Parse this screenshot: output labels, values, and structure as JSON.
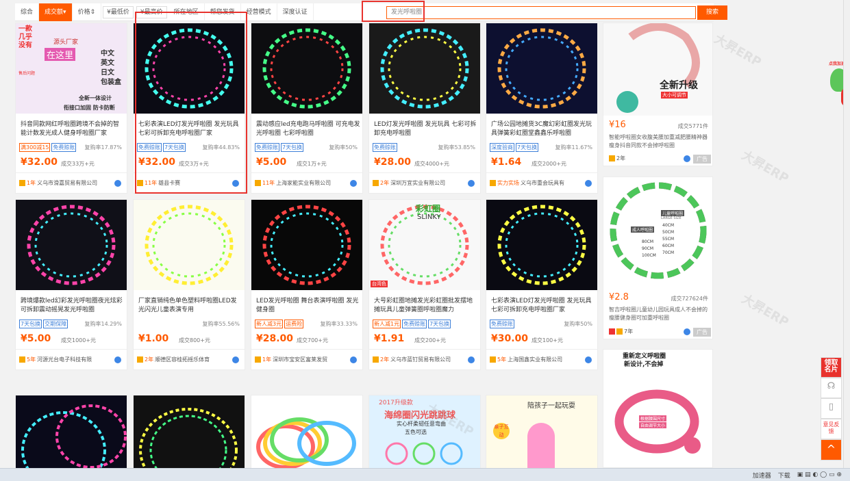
{
  "filter_bar": {
    "tabs": [
      "综合",
      "成交额",
      "价格"
    ],
    "price_min": "¥最低价",
    "price_max": "¥最高价",
    "filters": [
      "所在地区",
      "帮您发货",
      "经营模式",
      "深度认证"
    ],
    "search_placeholder": "发光呼啦圈",
    "search_button": "搜索"
  },
  "products": [
    {
      "title": "抖音同款网红呼啦圈跨境不会掉的智能计数发光成人健身呼啦圈厂家",
      "tags": [
        "满300减15",
        "免费赊账"
      ],
      "rate": "复购率17.87%",
      "price": "¥32.00",
      "deal": "成交33万+元",
      "years": "1年",
      "shop": "义乌市滑嘉贸易有限公司"
    },
    {
      "title": "七彩表演LED灯发光呼啦圈 发光玩具七彩可拆卸充电呼啦圈厂家",
      "tags": [
        "免费赊账",
        "7天包换"
      ],
      "rate": "复购率44.83%",
      "price": "¥32.00",
      "deal": "成交3万+元",
      "years": "11年",
      "shop": "雄县卡赛"
    },
    {
      "title": "震动感应led充电跑马呼啦圈 可充电发光呼啦圈 七彩呼啦圈",
      "tags": [
        "免费赊账",
        "7天包换"
      ],
      "rate": "复购率50%",
      "price": "¥5.00",
      "deal": "成交1万+元",
      "years": "11年",
      "shop": "上海家能实业有限公司"
    },
    {
      "title": "LED灯发光呼啦圈 发光玩具 七彩可拆卸充电呼啦圈",
      "tags": [
        "免费赊账"
      ],
      "rate": "复购率53.85%",
      "price": "¥28.00",
      "deal": "成交4000+元",
      "years": "2年",
      "shop": "深圳万宜实业有限公司"
    },
    {
      "title": "广场公园地摊货3C魔幻彩虹圈发光玩具弹簧彩虹圈堂鑫鑫乐呼啦圈",
      "tags": [
        "深度验商",
        "7天包换"
      ],
      "rate": "复购率11.67%",
      "price": "¥1.64",
      "deal": "成交2000+元",
      "years": "实力实场",
      "shop": "义乌市重会玩具有"
    },
    {
      "title": "跨境爆款led幻彩发光呼啦圈夜光炫彩可拆卸震动摇晃发光呼啦圈",
      "tags": [
        "7天包换",
        "交期保障"
      ],
      "rate": "复购率14.29%",
      "price": "¥5.00",
      "deal": "成交1000+元",
      "years": "5年",
      "shop": "河源光台电子科技有限"
    },
    {
      "title": "厂家直销纯色单色塑料呼啦圈LED发光闪光儿童表演专用",
      "tags": [],
      "rate": "复购率55.56%",
      "price": "¥1.00",
      "deal": "成交800+元",
      "years": "2年",
      "shop": "顺德区容桂拓摇乐体育"
    },
    {
      "title": "LED发光呼啦圈 舞台表演呼啦圈 发光健身圈",
      "tags": [
        "新人减3元",
        "运费险"
      ],
      "rate": "复购率33.33%",
      "price": "¥28.00",
      "deal": "成交700+元",
      "years": "1年",
      "shop": "深圳市宝安区富莱发贸"
    },
    {
      "title": "大号彩虹圈地摊发光彩虹圈批发摆地摊玩具儿童弹簧圈呼啦圈魔力",
      "tags": [
        "新人减1元",
        "免费赊账",
        "7天包换"
      ],
      "rate": "",
      "price": "¥1.91",
      "deal": "成交200+元",
      "years": "2年",
      "shop": "义乌市蓝钉贸易有限公司"
    },
    {
      "title": "七彩表演LED灯发光呼啦圈 发光玩具七彩可拆卸充电呼啦圈厂家",
      "tags": [
        "免费赊账"
      ],
      "rate": "复购率50%",
      "price": "¥30.00",
      "deal": "成交100+元",
      "years": "5年",
      "shop": "上海国鑫实业有限公司"
    }
  ],
  "image_captions": {
    "p1_lines": [
      "一款几乎没有",
      "售后问题",
      "源头厂家",
      "在这里",
      "中文",
      "英文",
      "日文",
      "包装盒",
      "全新一体设计",
      "衔接口加固 防卡防断"
    ],
    "slinky_top": "彩虹圈",
    "slinky_sub": "SLINKY",
    "slinky_label": "台湾色",
    "row3_ad1": "2017升级款",
    "row3_ad2": "海绵圈闪光跳跳球",
    "row3_ad3": "实心杆柔韧任意弯曲",
    "row3_ad4": "五色可选",
    "row3_kid": "陪孩子一起玩耍",
    "row3_kid_tag": "亲子互动",
    "sidebar1_top": "全新升级",
    "sidebar1_sub": "大小可调节",
    "sidebar2_title": "儿童呼啦圈",
    "sidebar2_size": "LARGE SIZE",
    "sidebar2_adult": "成人呼啦圈",
    "sidebar2_sizes": [
      "40CM",
      "50CM",
      "55CM",
      "60CM",
      "70CM"
    ],
    "sidebar2_sizes_b": [
      "80CM",
      "90CM",
      "100CM"
    ],
    "sidebar3_top": "重新定义呼啦圈",
    "sidebar3_sub": "新设计,不会掉",
    "sidebar3_b": "根据腰围尺寸",
    "sidebar3_c": "自由调节大小"
  },
  "ads": [
    {
      "price": "¥16",
      "deal": "成交5771件",
      "title": "智能呼啦圈女收腹美腰加重减肥腰精神器瘦身抖音同款不会掉呼啦圈",
      "years": "2年",
      "label": "广告"
    },
    {
      "price": "¥2.8",
      "deal": "成交727624件",
      "title": "智吉呼啦圈儿童幼儿园玩具成人不会掉的瘦腰健身圈可加重呼啦圈",
      "years": "7年",
      "label": "广告"
    }
  ],
  "float_tools": {
    "top": "领取名片",
    "feedback": "意见反馈",
    "back_top": "^"
  },
  "promo_badge": "点我加速",
  "statusbar": [
    "加速器",
    "下载"
  ],
  "watermark": "大昇ERP"
}
